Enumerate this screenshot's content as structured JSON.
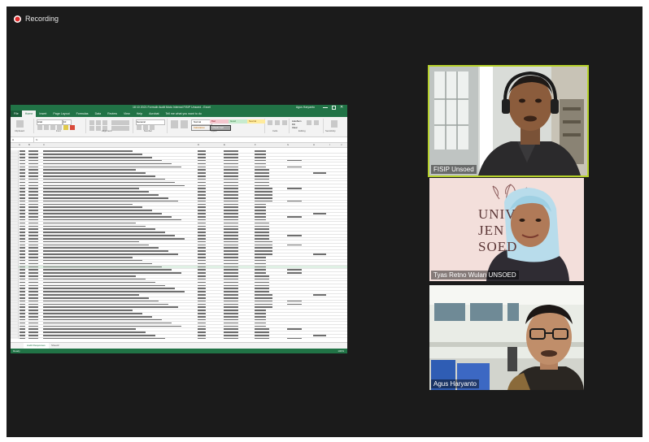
{
  "recording": {
    "label": "Recording"
  },
  "excel": {
    "title": "18 10 2021 Formulir Audit Mutu Internal FISIP Unsoed - Excel",
    "user": "Agus Haryanto",
    "tabs": [
      "File",
      "Home",
      "Insert",
      "Page Layout",
      "Formulas",
      "Data",
      "Review",
      "View",
      "Help",
      "Acrobat",
      "Tell me what you want to do"
    ],
    "ribbon": {
      "font_name": "Arial",
      "font_size": "10",
      "number_format": "General",
      "style_normal": "Normal",
      "style_bad": "Bad",
      "style_good": "Good",
      "style_neutral": "Neutral",
      "style_calculation": "Calculation",
      "style_check_cell": "Check Cell",
      "group_clipboard": "Clipboard",
      "group_font": "Font",
      "group_alignment": "Alignment",
      "group_number": "Number",
      "group_styles": "Styles",
      "group_cells": "Cells",
      "group_editing": "Editing",
      "group_sensitivity": "Sensitivity",
      "autosum": "AutoSum",
      "fill": "Fill",
      "clear": "Clear",
      "sort_filter": "Sort & Filter",
      "find_select": "Find & Select",
      "insert": "Insert",
      "delete": "Delete",
      "format": "Format"
    },
    "name_box": "H",
    "columns": [
      "A",
      "B",
      "C",
      "D",
      "E",
      "F",
      "G",
      "H",
      "I",
      "J"
    ],
    "sheets": [
      "Audit Responses",
      "Sheet2"
    ],
    "status": {
      "ready": "Ready",
      "zoom": "100%"
    },
    "colors": {
      "excel_green": "#217346"
    }
  },
  "participants": [
    {
      "name": "FISIP Unsoed",
      "active_speaker": true
    },
    {
      "name": "Tyas Retno Wulan UNSOED",
      "active_speaker": false,
      "background_text": [
        "UNIV",
        "JEN",
        "SOED"
      ]
    },
    {
      "name": "Agus Haryanto",
      "active_speaker": false
    }
  ],
  "colors": {
    "stage": "#1b1b1b",
    "active_border": "#b7d22b",
    "record": "#e02b2b"
  }
}
